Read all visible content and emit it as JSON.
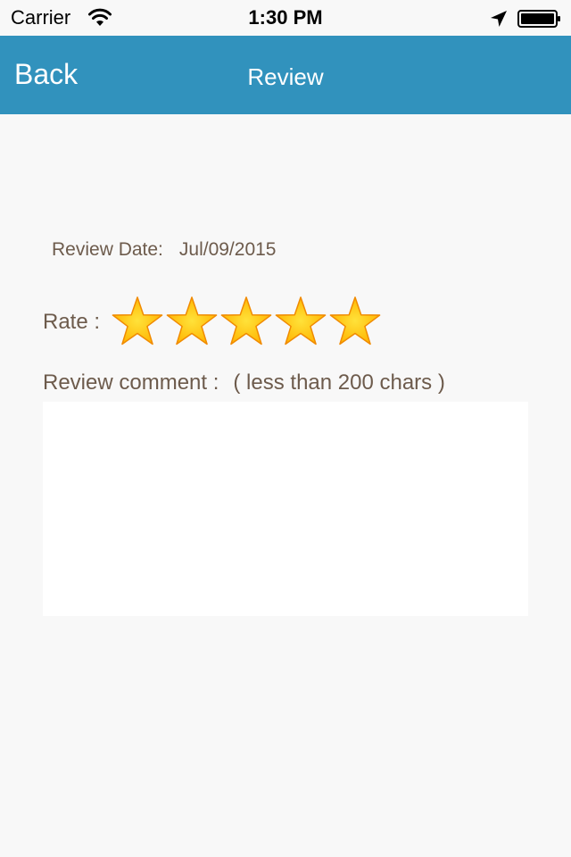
{
  "status_bar": {
    "carrier": "Carrier",
    "time": "1:30 PM",
    "icons": [
      "wifi-icon",
      "location-arrow-icon",
      "battery-icon"
    ]
  },
  "nav": {
    "back_label": "Back",
    "title": "Review"
  },
  "review": {
    "date_label": "Review Date:",
    "date_value": "Jul/09/2015",
    "rate_label": "Rate :",
    "rating": 5,
    "rating_max": 5,
    "comment_label": "Review comment :",
    "comment_hint": "( less than 200 chars )",
    "comment_value": ""
  },
  "colors": {
    "nav_background": "#3192bd",
    "label_text": "#6d5b4c",
    "star_fill": "#ffb400",
    "star_outline": "#f08a00"
  }
}
